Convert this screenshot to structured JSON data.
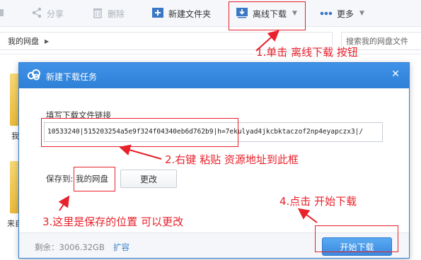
{
  "toolbar": {
    "share_label": "分享",
    "delete_label": "删除",
    "new_folder_label": "新建文件夹",
    "offline_download_label": "离线下载",
    "more_label": "更多"
  },
  "breadcrumb": {
    "current": "我的网盘",
    "search_placeholder": "搜索我的网盘文件"
  },
  "background": {
    "label_1": "我",
    "label_2": "来自"
  },
  "dialog": {
    "title": "新建下载任务",
    "url_field_label": "填写下载文件链接",
    "url_value": "10533240|515203254a5e9f324f04340eb6d762b9|h=7ekulyad4jkcbktaczof2np4eyapczx3|/",
    "save_to_label": "保存到:",
    "save_to_path": "我的网盘",
    "change_button": "更改",
    "free_space": "剩余：3006.32GB",
    "expand_link": "扩容",
    "start_button": "开始下载"
  },
  "annotations": {
    "step1": "1.单击 离线下载 按钮",
    "step2": "2.右键 粘贴 资源地址到此框",
    "step3": "3.这里是保存的位置 可以更改",
    "step4": "4.点击 开始下载"
  },
  "colors": {
    "annotation_red": "#e8212b",
    "dialog_blue": "#2f80d8",
    "button_blue": "#3a8ae0"
  }
}
